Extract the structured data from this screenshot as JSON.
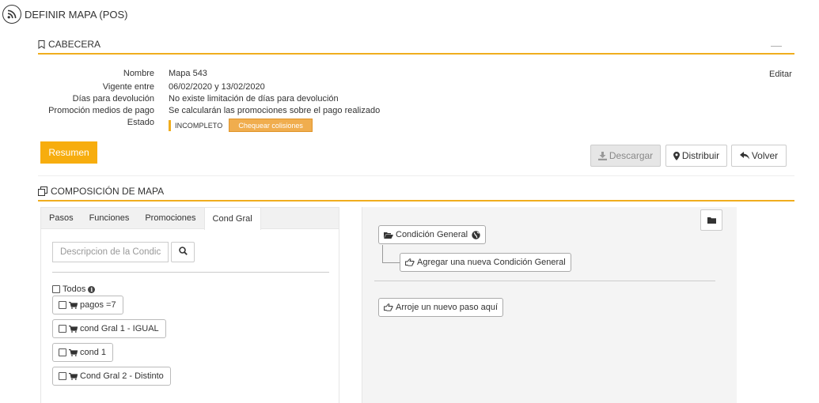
{
  "page": {
    "title": "DEFINIR MAPA (POS)"
  },
  "cabecera": {
    "title": "CABECERA",
    "collapse_label": "—",
    "edit_label": "Editar",
    "fields": [
      {
        "label": "Nombre",
        "value": "Mapa 543"
      },
      {
        "label": "Vigente entre",
        "value": "06/02/2020 y 13/02/2020"
      },
      {
        "label": "Días para devolución",
        "value": "No existe limitación de días para devolución"
      },
      {
        "label": "Promoción medios de pago",
        "value": "Se calcularán las promociones sobre el pago realizado"
      },
      {
        "label": "Estado",
        "value": ""
      }
    ],
    "estado": {
      "value": "INCOMPLETO",
      "check_button": "Chequear colisiones"
    }
  },
  "actions": {
    "resumen": "Resumen",
    "descargar": "Descargar",
    "distribuir": "Distribuir",
    "volver": "Volver"
  },
  "composicion": {
    "title": "COMPOSICIÓN DE MAPA",
    "tabs": [
      "Pasos",
      "Funciones",
      "Promociones",
      "Cond Gral"
    ],
    "active_tab": "Cond Gral",
    "search": {
      "placeholder": "Descripcion de la Condic"
    },
    "todos_label": "Todos",
    "conditions": [
      "pagos =7",
      "cond Gral 1 - IGUAL",
      "cond 1",
      "Cond Gral 2 - Distinto"
    ],
    "tree": {
      "root": "Condición General",
      "add_child": "Agregar una nueva Condición General",
      "drop_step": "Arroje un nuevo paso aquí"
    }
  },
  "colors": {
    "accent": "#f0ad1e",
    "resumen_bg": "#f7ad0e",
    "check_bg": "#f0ad4e"
  }
}
